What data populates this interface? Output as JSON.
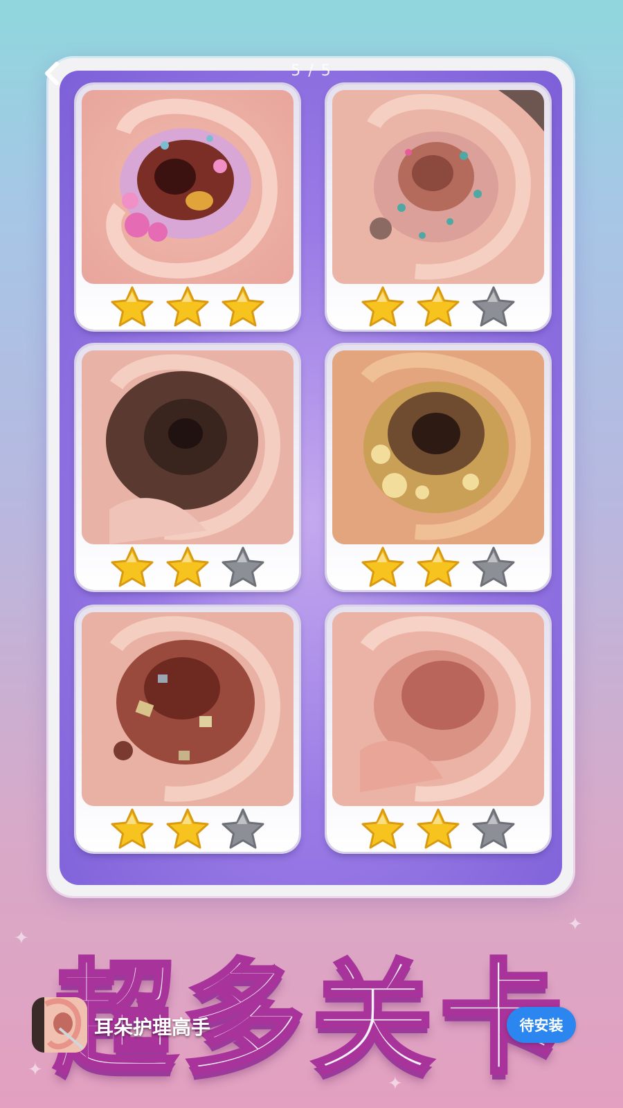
{
  "header": {
    "page_indicator": "5 / 5",
    "back_icon": "chevron-left-icon"
  },
  "levels": [
    {
      "stars": 3,
      "theme": "pink-debris"
    },
    {
      "stars": 2,
      "theme": "teal-debris"
    },
    {
      "stars": 2,
      "theme": "hairy-dark"
    },
    {
      "stars": 2,
      "theme": "yellow-wax"
    },
    {
      "stars": 2,
      "theme": "metal-debris"
    },
    {
      "stars": 2,
      "theme": "clean"
    }
  ],
  "banner": {
    "title": "超多关卡"
  },
  "app": {
    "name": "耳朵护理高手",
    "install_label": "待安装"
  },
  "colors": {
    "star_on": "#f7c41f",
    "star_off": "#8d8f96",
    "install": "#2c86f0",
    "title_outline": "#a8339a"
  }
}
